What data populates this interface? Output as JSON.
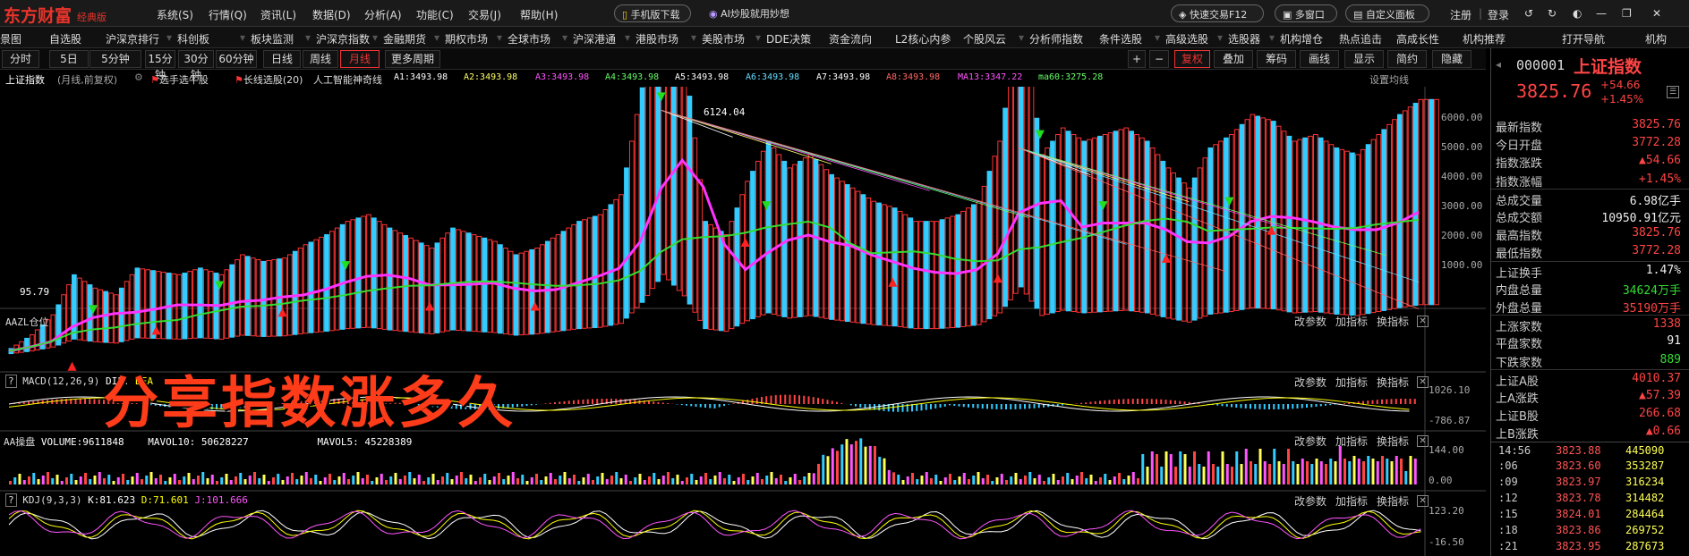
{
  "menubar": {
    "logo": "东方财富",
    "logo_sub": "经典版",
    "items": [
      "系统(S)",
      "行情(Q)",
      "资讯(L)",
      "数据(D)",
      "分析(A)",
      "功能(C)",
      "交易(J)",
      "帮助(H)"
    ],
    "mobile_btn": "手机版下载",
    "ai_btn": "AI炒股就用妙想",
    "quick_trade": "快速交易F12",
    "multi_window": "多窗口",
    "custom_panel": "自定义面板",
    "register": "注册",
    "login": "登录"
  },
  "nav2": [
    "景图",
    "自选股",
    "沪深京排行",
    "科创板",
    "板块监测",
    "沪深京指数",
    "金融期货",
    "期权市场",
    "全球市场",
    "沪深港通",
    "港股市场",
    "美股市场",
    "DDE决策",
    "资金流向",
    "L2核心内参",
    "个股风云",
    "分析师指数",
    "条件选股",
    "高级选股",
    "选股器",
    "机构增仓",
    "热点追击",
    "高成长性",
    "机构推荐",
    "打开导航",
    "机构"
  ],
  "period_tabs": [
    "分时",
    "5日",
    "5分钟",
    "15分钟",
    "30分钟",
    "60分钟",
    "日线",
    "周线",
    "月线",
    "更多周期"
  ],
  "active_tab": "月线",
  "toolbar_right": [
    "+",
    "−",
    "复权",
    "叠加",
    "筹码",
    "画线",
    "显示",
    "简约",
    "隐藏"
  ],
  "info_line": {
    "name": "上证指数",
    "desc": "(月线,前复权)",
    "picker": "选手选牛股",
    "long_pick": "长线选股(20)",
    "ai_line": "人工智能神奇线",
    "a1": "A1:3493.98",
    "a2": "A2:3493.98",
    "a3": "A3:3493.98",
    "a4": "A4:3493.98",
    "a5": "A5:3493.98",
    "a6": "A6:3493.98",
    "a7": "A7:3493.98",
    "a8": "A8:3493.98",
    "ma13": "MA13:3347.22",
    "ma60": "ma60:3275.28",
    "settings": "设置均线"
  },
  "main_chart": {
    "y_labels": [
      "6000.00",
      "5000.00",
      "4000.00",
      "3000.00",
      "2000.00",
      "1000.00"
    ],
    "high_label": "6124.04",
    "low_label": "95.79"
  },
  "panels": {
    "aazl": {
      "title": "AAZL仓位"
    },
    "macd": {
      "title": "MACD(12,26,9)",
      "dif": "DIF:",
      "dea": "DEA",
      "y_top": "1026.10",
      "y_bot": "-786.87"
    },
    "volume": {
      "title": "AA操盘",
      "vol": "VOLUME:9611848",
      "mavol10": "MAVOL10:",
      "mavol10_val": "50628227",
      "mavol5": "MAVOL5:",
      "mavol5_val": "45228389",
      "y_top": "144.00",
      "y_bot": "0.00"
    },
    "kdj": {
      "title": "KDJ(9,3,3)",
      "k": "K:81.623",
      "d": "D:71.601",
      "j": "J:101.666",
      "y_top": "123.20",
      "y_bot": "-16.50"
    },
    "tools": [
      "改参数",
      "加指标",
      "换指标"
    ]
  },
  "overlay_text": "分享指数涨多久",
  "right_panel": {
    "code": "000001",
    "name": "上证指数",
    "price": "3825.76",
    "change": "+54.66",
    "change_pct": "+1.45%",
    "rows": [
      {
        "label": "最新指数",
        "value": "3825.76",
        "color": "red"
      },
      {
        "label": "今日开盘",
        "value": "3772.28",
        "color": "red"
      },
      {
        "label": "指数涨跌",
        "value": "▲54.66",
        "color": "red"
      },
      {
        "label": "指数涨幅",
        "value": "+1.45%",
        "color": "red"
      },
      {
        "label": "总成交量",
        "value": "6.98亿手",
        "color": "white"
      },
      {
        "label": "总成交额",
        "value": "10950.91亿元",
        "color": "white"
      },
      {
        "label": "最高指数",
        "value": "3825.76",
        "color": "red"
      },
      {
        "label": "最低指数",
        "value": "3772.28",
        "color": "red"
      },
      {
        "label": "上证换手",
        "value": "1.47%",
        "color": "white"
      },
      {
        "label": "内盘总量",
        "value": "34624万手",
        "color": "green"
      },
      {
        "label": "外盘总量",
        "value": "35190万手",
        "color": "red"
      },
      {
        "label": "上涨家数",
        "value": "1338",
        "color": "red"
      },
      {
        "label": "平盘家数",
        "value": "91",
        "color": "white"
      },
      {
        "label": "下跌家数",
        "value": "889",
        "color": "green"
      },
      {
        "label": "上证A股",
        "value": "4010.37",
        "color": "red"
      },
      {
        "label": "上A涨跌",
        "value": "▲57.39",
        "color": "red"
      },
      {
        "label": "上证B股",
        "value": "266.68",
        "color": "red"
      },
      {
        "label": "上B涨跌",
        "value": "▲0.66",
        "color": "red"
      }
    ],
    "ticks": [
      {
        "time": "14:56",
        "price": "3823.88",
        "vol": "445090"
      },
      {
        "time": ":06",
        "price": "3823.60",
        "vol": "353287"
      },
      {
        "time": ":09",
        "price": "3823.97",
        "vol": "316234"
      },
      {
        "time": ":12",
        "price": "3823.78",
        "vol": "314482"
      },
      {
        "time": ":15",
        "price": "3824.01",
        "vol": "284464"
      },
      {
        "time": ":18",
        "price": "3823.86",
        "vol": "269752"
      },
      {
        "time": ":21",
        "price": "3823.95",
        "vol": "287673"
      }
    ]
  }
}
